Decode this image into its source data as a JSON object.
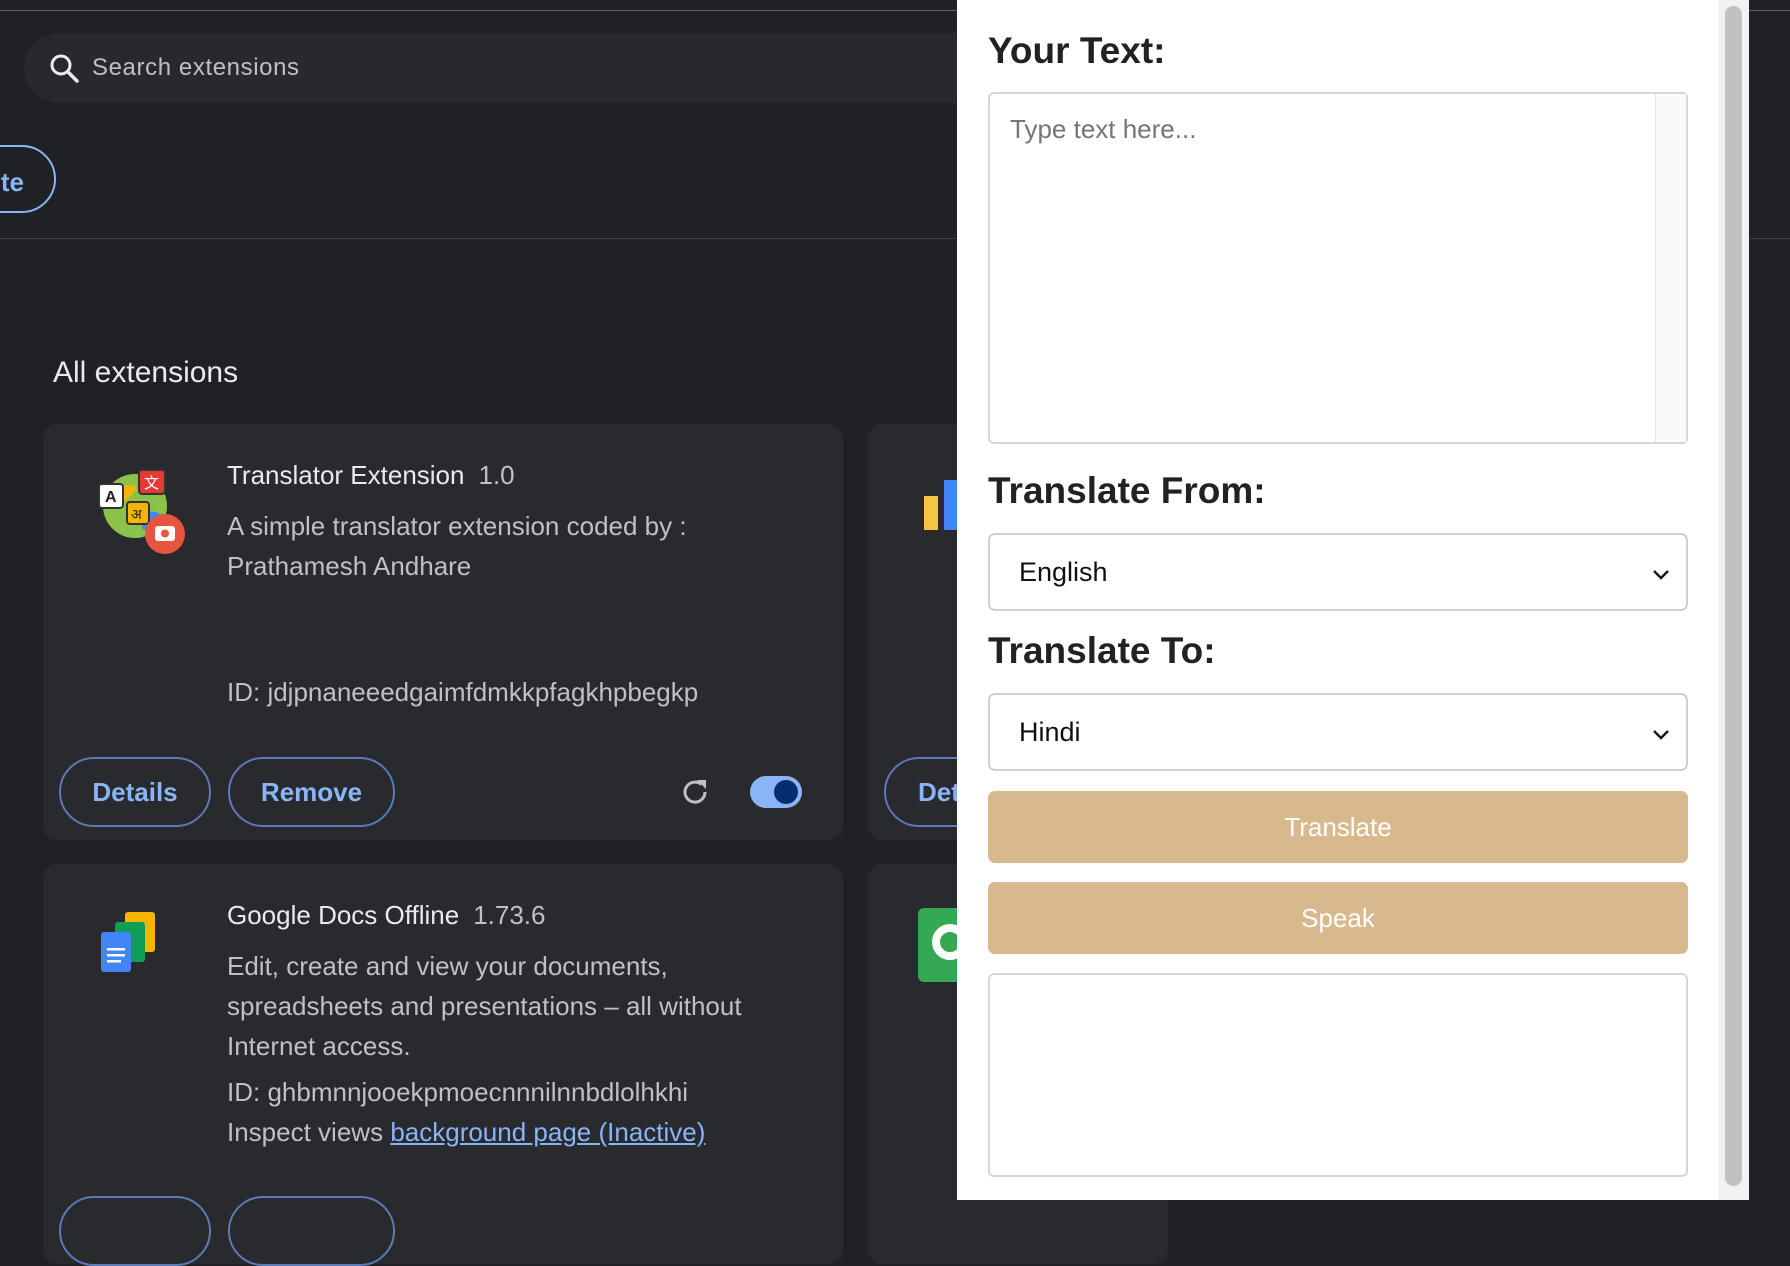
{
  "search": {
    "placeholder": "Search extensions"
  },
  "toolbar": {
    "partial_button_label": "te"
  },
  "section": {
    "title": "All extensions"
  },
  "extensions": [
    {
      "name": "Translator Extension",
      "version": "1.0",
      "description": "A simple translator extension coded by : Prathamesh Andhare",
      "id_label": "ID: jdjpnaneeedgaimfdmkkpfagkhpbegkp",
      "details_label": "Details",
      "remove_label": "Remove",
      "enabled": true
    },
    {
      "name": "Google Docs Offline",
      "version": "1.73.6",
      "description": "Edit, create and view your documents, spreadsheets and presentations – all without Internet access.",
      "id_label": "ID: ghbmnnjooekpmoecnnnilnnbdlolhkhi",
      "inspect_label": "Inspect views",
      "inspect_link": "background page (Inactive)"
    }
  ],
  "partial_card": {
    "details_label_partial": "Det"
  },
  "popup": {
    "your_text_label": "Your Text:",
    "text_placeholder": "Type text here...",
    "from_label": "Translate From:",
    "from_value": "English",
    "to_label": "Translate To:",
    "to_value": "Hindi",
    "translate_button": "Translate",
    "speak_button": "Speak",
    "output_text": ""
  },
  "colors": {
    "accent": "#8ab4f8",
    "button_tan": "#d7b98d",
    "background": "#202124",
    "card": "#292a2d"
  }
}
